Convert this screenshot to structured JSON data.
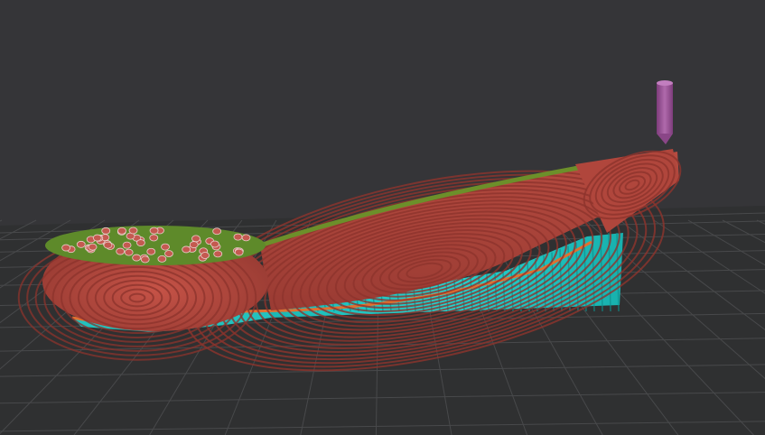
{
  "app": {
    "view": "3d-print-preview"
  },
  "colors": {
    "background": "#353538",
    "bed": "#2f3031",
    "grid_line": "#4a4b4d",
    "wall_red": "#b44a3f",
    "wall_red_dark": "#8f352e",
    "wall_red_light": "#cf5f50",
    "infill_green": "#5a8a2a",
    "support_cyan": "#20c7c3",
    "support_cyan_dark": "#0f8f8c",
    "skirt_orange": "#e07030",
    "nozzle_purple": "#9a4f97"
  },
  "objects": [
    {
      "name": "spoon-bowl",
      "type": "model"
    },
    {
      "name": "spoon-handle",
      "type": "model"
    },
    {
      "name": "support-structure",
      "type": "support"
    },
    {
      "name": "nozzle",
      "type": "toolhead"
    }
  ]
}
